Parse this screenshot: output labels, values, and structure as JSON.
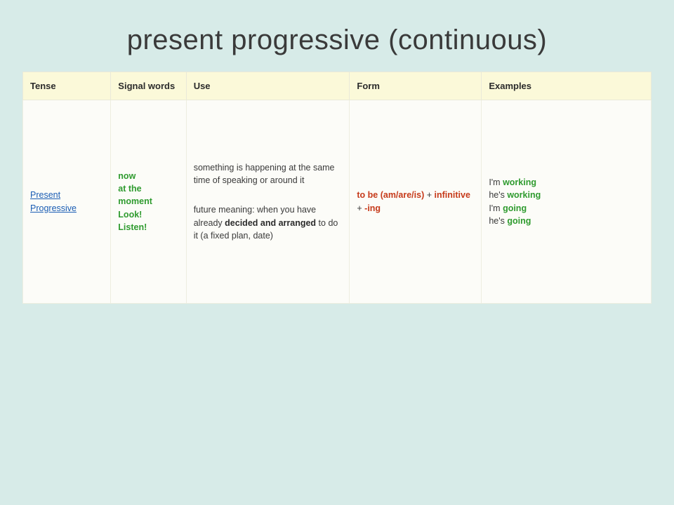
{
  "title": "present progressive (continuous)",
  "headers": {
    "tense": "Tense",
    "signal": "Signal words",
    "use": "Use",
    "form": "Form",
    "examples": "Examples"
  },
  "row": {
    "tense": {
      "line1": "Present",
      "line2": "Progressive"
    },
    "signal": {
      "l1": "now",
      "l2": "at the",
      "l3": "moment",
      "l4": "Look!",
      "l5": "Listen!"
    },
    "use": {
      "p1": "something is happening at the same time of speaking or around it",
      "p2a": "future meaning: when you have already ",
      "p2b": "decided and arranged",
      "p2c": " to do it (a fixed plan, date)"
    },
    "form": {
      "a": "to be (am/are/is)",
      "plus": " + ",
      "b": "infinitive",
      "plus2": " + ",
      "c": "-ing"
    },
    "examples": {
      "e1a": "I'm ",
      "e1b": "working",
      "e2a": "he's ",
      "e2b": "working",
      "e3a": "I'm ",
      "e3b": "going",
      "e4a": "he's ",
      "e4b": "going"
    }
  }
}
